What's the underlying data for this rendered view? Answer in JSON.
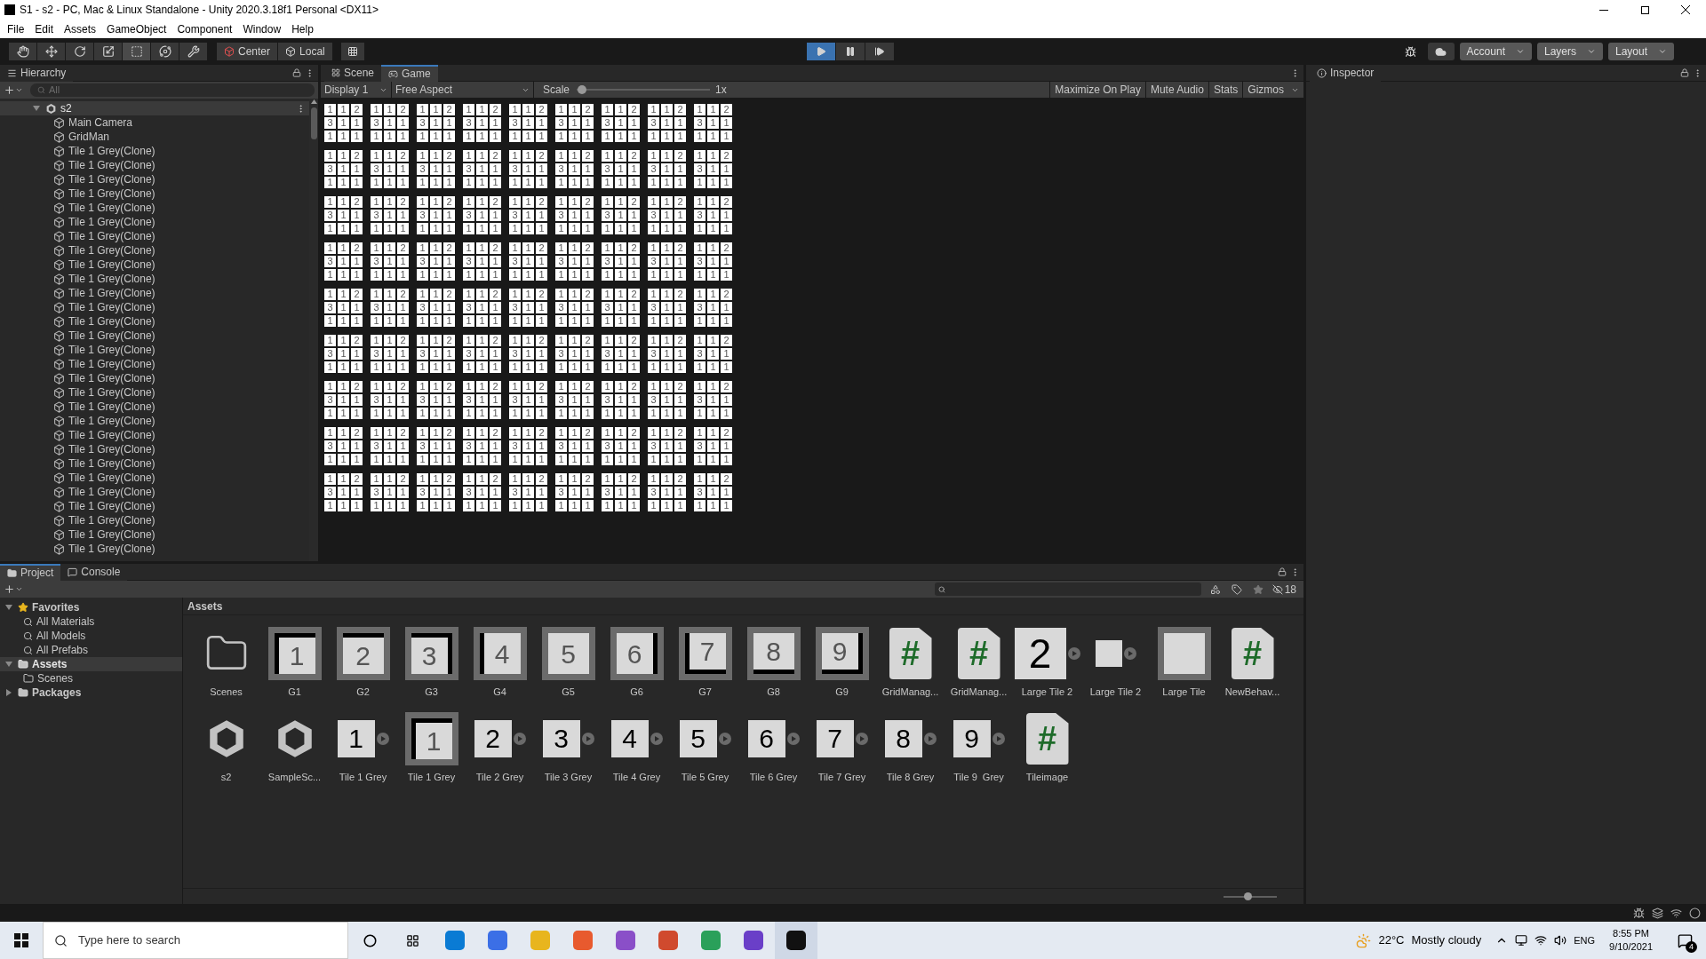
{
  "window": {
    "title": "S1 - s2 - PC, Mac & Linux Standalone - Unity 2020.3.18f1 Personal <DX11>"
  },
  "menu": [
    "File",
    "Edit",
    "Assets",
    "GameObject",
    "Component",
    "Window",
    "Help"
  ],
  "toolbar": {
    "pivot": "Center",
    "space": "Local",
    "play": {
      "on": true
    },
    "pause": {
      "on": false
    },
    "account": "Account",
    "layers": "Layers",
    "layout": "Layout"
  },
  "hierarchy": {
    "tab": "Hierarchy",
    "search_placeholder": "All",
    "tree": [
      {
        "label": "s2",
        "kind": "scene",
        "expanded": true,
        "children": [
          {
            "label": "Main Camera",
            "kind": "object"
          },
          {
            "label": "GridMan",
            "kind": "object"
          },
          {
            "label": "Tile 1 Grey(Clone)",
            "kind": "object"
          },
          {
            "label": "Tile 1 Grey(Clone)",
            "kind": "object"
          },
          {
            "label": "Tile 1 Grey(Clone)",
            "kind": "object"
          },
          {
            "label": "Tile 1 Grey(Clone)",
            "kind": "object"
          },
          {
            "label": "Tile 1 Grey(Clone)",
            "kind": "object"
          },
          {
            "label": "Tile 1 Grey(Clone)",
            "kind": "object"
          },
          {
            "label": "Tile 1 Grey(Clone)",
            "kind": "object"
          },
          {
            "label": "Tile 1 Grey(Clone)",
            "kind": "object"
          },
          {
            "label": "Tile 1 Grey(Clone)",
            "kind": "object"
          },
          {
            "label": "Tile 1 Grey(Clone)",
            "kind": "object"
          },
          {
            "label": "Tile 1 Grey(Clone)",
            "kind": "object"
          },
          {
            "label": "Tile 1 Grey(Clone)",
            "kind": "object"
          },
          {
            "label": "Tile 1 Grey(Clone)",
            "kind": "object"
          },
          {
            "label": "Tile 1 Grey(Clone)",
            "kind": "object"
          },
          {
            "label": "Tile 1 Grey(Clone)",
            "kind": "object"
          },
          {
            "label": "Tile 1 Grey(Clone)",
            "kind": "object"
          },
          {
            "label": "Tile 1 Grey(Clone)",
            "kind": "object"
          },
          {
            "label": "Tile 1 Grey(Clone)",
            "kind": "object"
          },
          {
            "label": "Tile 1 Grey(Clone)",
            "kind": "object"
          },
          {
            "label": "Tile 1 Grey(Clone)",
            "kind": "object"
          },
          {
            "label": "Tile 1 Grey(Clone)",
            "kind": "object"
          },
          {
            "label": "Tile 1 Grey(Clone)",
            "kind": "object"
          },
          {
            "label": "Tile 1 Grey(Clone)",
            "kind": "object"
          },
          {
            "label": "Tile 1 Grey(Clone)",
            "kind": "object"
          },
          {
            "label": "Tile 1 Grey(Clone)",
            "kind": "object"
          },
          {
            "label": "Tile 1 Grey(Clone)",
            "kind": "object"
          },
          {
            "label": "Tile 1 Grey(Clone)",
            "kind": "object"
          },
          {
            "label": "Tile 1 Grey(Clone)",
            "kind": "object"
          },
          {
            "label": "Tile 1 Grey(Clone)",
            "kind": "object"
          }
        ]
      }
    ]
  },
  "view_tabs": [
    {
      "label": "Scene",
      "selected": false
    },
    {
      "label": "Game",
      "selected": true
    }
  ],
  "game_toolbar": {
    "display": "Display 1",
    "aspect": "Free Aspect",
    "scale_label": "Scale",
    "scale": {
      "level": 0.02
    },
    "scale_value": "1x",
    "buttons": [
      "Maximize On Play",
      "Mute Audio",
      "Stats"
    ],
    "gizmos": "Gizmos"
  },
  "game_view": {
    "blocks": [
      [
        "1",
        "1",
        "2",
        "3",
        "1",
        "1",
        "1",
        "1",
        "1"
      ],
      [
        "1",
        "1",
        "2",
        "3",
        "1",
        "1",
        "1",
        "1",
        "1"
      ],
      [
        "1",
        "1",
        "2",
        "3",
        "1",
        "1",
        "1",
        "1",
        "1"
      ],
      [
        "1",
        "1",
        "2",
        "3",
        "1",
        "1",
        "1",
        "1",
        "1"
      ],
      [
        "1",
        "1",
        "2",
        "3",
        "1",
        "1",
        "1",
        "1",
        "1"
      ],
      [
        "1",
        "1",
        "2",
        "3",
        "1",
        "1",
        "1",
        "1",
        "1"
      ],
      [
        "1",
        "1",
        "2",
        "3",
        "1",
        "1",
        "1",
        "1",
        "1"
      ],
      [
        "1",
        "1",
        "2",
        "3",
        "1",
        "1",
        "1",
        "1",
        "1"
      ],
      [
        "1",
        "1",
        "2",
        "3",
        "1",
        "1",
        "1",
        "1",
        "1"
      ],
      [
        "1",
        "1",
        "2",
        "3",
        "1",
        "1",
        "1",
        "1",
        "1"
      ],
      [
        "1",
        "1",
        "2",
        "3",
        "1",
        "1",
        "1",
        "1",
        "1"
      ],
      [
        "1",
        "1",
        "2",
        "3",
        "1",
        "1",
        "1",
        "1",
        "1"
      ],
      [
        "1",
        "1",
        "2",
        "3",
        "1",
        "1",
        "1",
        "1",
        "1"
      ],
      [
        "1",
        "1",
        "2",
        "3",
        "1",
        "1",
        "1",
        "1",
        "1"
      ],
      [
        "1",
        "1",
        "2",
        "3",
        "1",
        "1",
        "1",
        "1",
        "1"
      ],
      [
        "1",
        "1",
        "2",
        "3",
        "1",
        "1",
        "1",
        "1",
        "1"
      ],
      [
        "1",
        "1",
        "2",
        "3",
        "1",
        "1",
        "1",
        "1",
        "1"
      ],
      [
        "1",
        "1",
        "2",
        "3",
        "1",
        "1",
        "1",
        "1",
        "1"
      ],
      [
        "1",
        "1",
        "2",
        "3",
        "1",
        "1",
        "1",
        "1",
        "1"
      ],
      [
        "1",
        "1",
        "2",
        "3",
        "1",
        "1",
        "1",
        "1",
        "1"
      ],
      [
        "1",
        "1",
        "2",
        "3",
        "1",
        "1",
        "1",
        "1",
        "1"
      ],
      [
        "1",
        "1",
        "2",
        "3",
        "1",
        "1",
        "1",
        "1",
        "1"
      ],
      [
        "1",
        "1",
        "2",
        "3",
        "1",
        "1",
        "1",
        "1",
        "1"
      ],
      [
        "1",
        "1",
        "2",
        "3",
        "1",
        "1",
        "1",
        "1",
        "1"
      ],
      [
        "1",
        "1",
        "2",
        "3",
        "1",
        "1",
        "1",
        "1",
        "1"
      ],
      [
        "1",
        "1",
        "2",
        "3",
        "1",
        "1",
        "1",
        "1",
        "1"
      ],
      [
        "1",
        "1",
        "2",
        "3",
        "1",
        "1",
        "1",
        "1",
        "1"
      ],
      [
        "1",
        "1",
        "2",
        "3",
        "1",
        "1",
        "1",
        "1",
        "1"
      ],
      [
        "1",
        "1",
        "2",
        "3",
        "1",
        "1",
        "1",
        "1",
        "1"
      ],
      [
        "1",
        "1",
        "2",
        "3",
        "1",
        "1",
        "1",
        "1",
        "1"
      ],
      [
        "1",
        "1",
        "2",
        "3",
        "1",
        "1",
        "1",
        "1",
        "1"
      ],
      [
        "1",
        "1",
        "2",
        "3",
        "1",
        "1",
        "1",
        "1",
        "1"
      ],
      [
        "1",
        "1",
        "2",
        "3",
        "1",
        "1",
        "1",
        "1",
        "1"
      ],
      [
        "1",
        "1",
        "2",
        "3",
        "1",
        "1",
        "1",
        "1",
        "1"
      ],
      [
        "1",
        "1",
        "2",
        "3",
        "1",
        "1",
        "1",
        "1",
        "1"
      ],
      [
        "1",
        "1",
        "2",
        "3",
        "1",
        "1",
        "1",
        "1",
        "1"
      ],
      [
        "1",
        "1",
        "2",
        "3",
        "1",
        "1",
        "1",
        "1",
        "1"
      ],
      [
        "1",
        "1",
        "2",
        "3",
        "1",
        "1",
        "1",
        "1",
        "1"
      ],
      [
        "1",
        "1",
        "2",
        "3",
        "1",
        "1",
        "1",
        "1",
        "1"
      ],
      [
        "1",
        "1",
        "2",
        "3",
        "1",
        "1",
        "1",
        "1",
        "1"
      ],
      [
        "1",
        "1",
        "2",
        "3",
        "1",
        "1",
        "1",
        "1",
        "1"
      ],
      [
        "1",
        "1",
        "2",
        "3",
        "1",
        "1",
        "1",
        "1",
        "1"
      ],
      [
        "1",
        "1",
        "2",
        "3",
        "1",
        "1",
        "1",
        "1",
        "1"
      ],
      [
        "1",
        "1",
        "2",
        "3",
        "1",
        "1",
        "1",
        "1",
        "1"
      ],
      [
        "1",
        "1",
        "2",
        "3",
        "1",
        "1",
        "1",
        "1",
        "1"
      ],
      [
        "1",
        "1",
        "2",
        "3",
        "1",
        "1",
        "1",
        "1",
        "1"
      ],
      [
        "1",
        "1",
        "2",
        "3",
        "1",
        "1",
        "1",
        "1",
        "1"
      ],
      [
        "1",
        "1",
        "2",
        "3",
        "1",
        "1",
        "1",
        "1",
        "1"
      ],
      [
        "1",
        "1",
        "2",
        "3",
        "1",
        "1",
        "1",
        "1",
        "1"
      ],
      [
        "1",
        "1",
        "2",
        "3",
        "1",
        "1",
        "1",
        "1",
        "1"
      ],
      [
        "1",
        "1",
        "2",
        "3",
        "1",
        "1",
        "1",
        "1",
        "1"
      ],
      [
        "1",
        "1",
        "2",
        "3",
        "1",
        "1",
        "1",
        "1",
        "1"
      ],
      [
        "1",
        "1",
        "2",
        "3",
        "1",
        "1",
        "1",
        "1",
        "1"
      ],
      [
        "1",
        "1",
        "2",
        "3",
        "1",
        "1",
        "1",
        "1",
        "1"
      ],
      [
        "1",
        "1",
        "2",
        "3",
        "1",
        "1",
        "1",
        "1",
        "1"
      ],
      [
        "1",
        "1",
        "2",
        "3",
        "1",
        "1",
        "1",
        "1",
        "1"
      ],
      [
        "1",
        "1",
        "2",
        "3",
        "1",
        "1",
        "1",
        "1",
        "1"
      ],
      [
        "1",
        "1",
        "2",
        "3",
        "1",
        "1",
        "1",
        "1",
        "1"
      ],
      [
        "1",
        "1",
        "2",
        "3",
        "1",
        "1",
        "1",
        "1",
        "1"
      ],
      [
        "1",
        "1",
        "2",
        "3",
        "1",
        "1",
        "1",
        "1",
        "1"
      ],
      [
        "1",
        "1",
        "2",
        "3",
        "1",
        "1",
        "1",
        "1",
        "1"
      ],
      [
        "1",
        "1",
        "2",
        "3",
        "1",
        "1",
        "1",
        "1",
        "1"
      ],
      [
        "1",
        "1",
        "2",
        "3",
        "1",
        "1",
        "1",
        "1",
        "1"
      ],
      [
        "1",
        "1",
        "2",
        "3",
        "1",
        "1",
        "1",
        "1",
        "1"
      ],
      [
        "1",
        "1",
        "2",
        "3",
        "1",
        "1",
        "1",
        "1",
        "1"
      ],
      [
        "1",
        "1",
        "2",
        "3",
        "1",
        "1",
        "1",
        "1",
        "1"
      ],
      [
        "1",
        "1",
        "2",
        "3",
        "1",
        "1",
        "1",
        "1",
        "1"
      ],
      [
        "1",
        "1",
        "2",
        "3",
        "1",
        "1",
        "1",
        "1",
        "1"
      ],
      [
        "1",
        "1",
        "2",
        "3",
        "1",
        "1",
        "1",
        "1",
        "1"
      ],
      [
        "1",
        "1",
        "2",
        "3",
        "1",
        "1",
        "1",
        "1",
        "1"
      ],
      [
        "1",
        "1",
        "2",
        "3",
        "1",
        "1",
        "1",
        "1",
        "1"
      ],
      [
        "1",
        "1",
        "2",
        "3",
        "1",
        "1",
        "1",
        "1",
        "1"
      ],
      [
        "1",
        "1",
        "2",
        "3",
        "1",
        "1",
        "1",
        "1",
        "1"
      ],
      [
        "1",
        "1",
        "2",
        "3",
        "1",
        "1",
        "1",
        "1",
        "1"
      ],
      [
        "1",
        "1",
        "2",
        "3",
        "1",
        "1",
        "1",
        "1",
        "1"
      ],
      [
        "1",
        "1",
        "2",
        "3",
        "1",
        "1",
        "1",
        "1",
        "1"
      ],
      [
        "1",
        "1",
        "2",
        "3",
        "1",
        "1",
        "1",
        "1",
        "1"
      ],
      [
        "1",
        "1",
        "2",
        "3",
        "1",
        "1",
        "1",
        "1",
        "1"
      ],
      [
        "1",
        "1",
        "2",
        "3",
        "1",
        "1",
        "1",
        "1",
        "1"
      ],
      [
        "1",
        "1",
        "2",
        "3",
        "1",
        "1",
        "1",
        "1",
        "1"
      ],
      [
        "1",
        "1",
        "2",
        "3",
        "1",
        "1",
        "1",
        "1",
        "1"
      ]
    ]
  },
  "inspector": {
    "tab": "Inspector"
  },
  "bottom_tabs": [
    {
      "label": "Project",
      "selected": true
    },
    {
      "label": "Console",
      "selected": false
    }
  ],
  "project": {
    "hidden_count": "18",
    "tree": [
      {
        "label": "Favorites",
        "kind": "favorites",
        "expanded": true,
        "selected": false,
        "children": [
          {
            "label": "All Materials",
            "kind": "search",
            "selected": false
          },
          {
            "label": "All Models",
            "kind": "search",
            "selected": false
          },
          {
            "label": "All Prefabs",
            "kind": "search",
            "selected": false
          }
        ]
      },
      {
        "label": "Assets",
        "kind": "folder",
        "expanded": true,
        "selected": true,
        "children": [
          {
            "label": "Scenes",
            "kind": "folder",
            "selected": false
          }
        ]
      },
      {
        "label": "Packages",
        "kind": "folder",
        "expanded": false,
        "selected": false
      }
    ],
    "breadcrumb": "Assets",
    "items": [
      {
        "label": "Scenes",
        "kind": "folder"
      },
      {
        "label": "G1",
        "kind": "texture",
        "glyph": "1",
        "edge_top": true,
        "edge_right": false,
        "edge_bottom": false,
        "edge_left": true
      },
      {
        "label": "G2",
        "kind": "texture",
        "glyph": "2",
        "edge_top": true,
        "edge_right": false,
        "edge_bottom": false,
        "edge_left": false
      },
      {
        "label": "G3",
        "kind": "texture",
        "glyph": "3",
        "edge_top": true,
        "edge_right": true,
        "edge_bottom": false,
        "edge_left": false
      },
      {
        "label": "G4",
        "kind": "texture",
        "glyph": "4",
        "edge_top": false,
        "edge_right": false,
        "edge_bottom": false,
        "edge_left": true
      },
      {
        "label": "G5",
        "kind": "texture",
        "glyph": "5",
        "edge_top": false,
        "edge_right": false,
        "edge_bottom": false,
        "edge_left": false
      },
      {
        "label": "G6",
        "kind": "texture",
        "glyph": "6",
        "edge_top": false,
        "edge_right": true,
        "edge_bottom": false,
        "edge_left": false
      },
      {
        "label": "G7",
        "kind": "texture",
        "glyph": "7",
        "edge_top": false,
        "edge_right": false,
        "edge_bottom": true,
        "edge_left": true
      },
      {
        "label": "G8",
        "kind": "texture",
        "glyph": "8",
        "edge_top": false,
        "edge_right": false,
        "edge_bottom": true,
        "edge_left": false
      },
      {
        "label": "G9",
        "kind": "texture",
        "glyph": "9",
        "edge_top": false,
        "edge_right": true,
        "edge_bottom": true,
        "edge_left": false
      },
      {
        "label": "GridManag...",
        "kind": "script",
        "glyph": "#"
      },
      {
        "label": "GridManag...",
        "kind": "script",
        "glyph": "#"
      },
      {
        "label": "Large Tile 2",
        "kind": "bigprefab",
        "glyph": "2"
      },
      {
        "label": "Large Tile 2",
        "kind": "smallprefab"
      },
      {
        "label": "Large Tile",
        "kind": "texture",
        "edge_top": false,
        "edge_right": false,
        "edge_bottom": false,
        "edge_left": false
      },
      {
        "label": "NewBehav...",
        "kind": "script",
        "glyph": "#"
      },
      {
        "label": "s2",
        "kind": "scene"
      },
      {
        "label": "SampleSc...",
        "kind": "scene"
      },
      {
        "label": "Tile 1 Grey",
        "kind": "prefab",
        "glyph": "1"
      },
      {
        "label": "Tile 1 Grey",
        "kind": "texture",
        "glyph": "1",
        "edge_top": true,
        "edge_right": false,
        "edge_bottom": false,
        "edge_left": true
      },
      {
        "label": "Tile 2 Grey",
        "kind": "prefab",
        "glyph": "2"
      },
      {
        "label": "Tile 3 Grey",
        "kind": "prefab",
        "glyph": "3"
      },
      {
        "label": "Tile 4 Grey",
        "kind": "prefab",
        "glyph": "4"
      },
      {
        "label": "Tile 5 Grey",
        "kind": "prefab",
        "glyph": "5"
      },
      {
        "label": "Tile 6 Grey",
        "kind": "prefab",
        "glyph": "6"
      },
      {
        "label": "Tile 7 Grey",
        "kind": "prefab",
        "glyph": "7"
      },
      {
        "label": "Tile 8 Grey",
        "kind": "prefab",
        "glyph": "8"
      },
      {
        "label": "Tile 9  Grey",
        "kind": "prefab",
        "glyph": "9"
      },
      {
        "label": "Tileimage",
        "kind": "script",
        "glyph": "#"
      }
    ],
    "icon_size": {
      "level": 0.45
    }
  },
  "taskbar": {
    "search_placeholder": "Type here to search",
    "temperature": "22°C",
    "weather": "Mostly cloudy",
    "language": "ENG",
    "time": "8:55 PM",
    "date": "9/10/2021",
    "notifications": "4"
  }
}
